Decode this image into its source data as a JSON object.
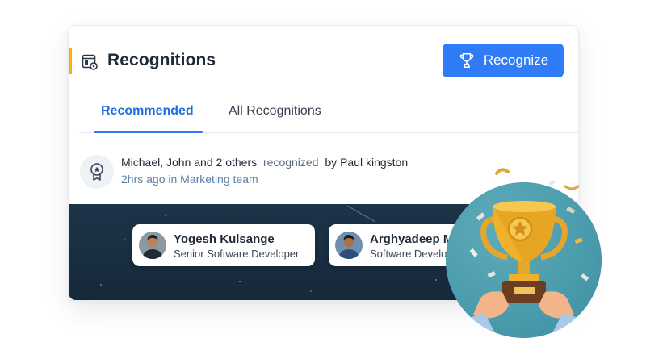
{
  "header": {
    "title": "Recognitions",
    "recognize_button": "Recognize",
    "icon": "settings-panel-icon",
    "accent_color": "#f5b400",
    "button_color": "#2f7cf6"
  },
  "tabs": [
    {
      "label": "Recommended",
      "active": true
    },
    {
      "label": "All Recognitions",
      "active": false
    }
  ],
  "feed": {
    "recipients": "Michael, John and 2 others",
    "verb": "recognized",
    "by": "by Paul kingston",
    "meta": "2hrs ago in Marketing team",
    "icon": "award-ribbon-icon"
  },
  "people": [
    {
      "name": "Yogesh Kulsange",
      "role": "Senior Software Developer"
    },
    {
      "name": "Arghyadeep Mondal",
      "role": "Software Developer"
    }
  ],
  "illustration": {
    "icon": "trophy-celebration-illustration",
    "circle_color": "#4c9fb0",
    "trophy_color": "#f2b12a"
  }
}
